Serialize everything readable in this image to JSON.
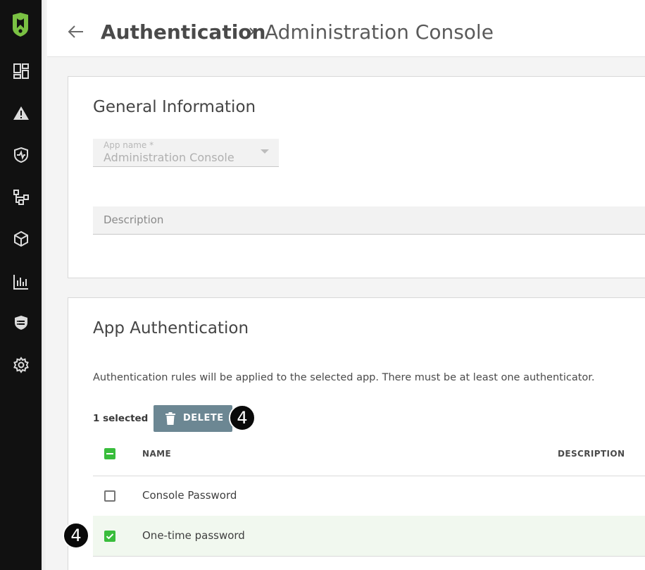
{
  "header": {
    "title": "Authentication",
    "subtitle": "Administration Console"
  },
  "sidebar": {
    "items": [
      {
        "icon": "dashboard-icon"
      },
      {
        "icon": "alert-icon"
      },
      {
        "icon": "shield-pulse-icon"
      },
      {
        "icon": "workflow-icon"
      },
      {
        "icon": "cube-icon"
      },
      {
        "icon": "bar-chart-icon"
      },
      {
        "icon": "policy-shield-icon"
      },
      {
        "icon": "gear-icon"
      }
    ]
  },
  "general": {
    "title": "General Information",
    "app_name_label": "App name *",
    "app_name_value": "Administration Console",
    "description_placeholder": "Description"
  },
  "auth": {
    "title": "App Authentication",
    "help": "Authentication rules will be applied to the selected app. There must be at least one authenticator.",
    "selected_count": "1 selected",
    "delete_label": "DELETE",
    "callout": "4",
    "columns": {
      "name": "NAME",
      "description": "DESCRIPTION"
    },
    "rows": [
      {
        "name": "Console Password",
        "checked": false
      },
      {
        "name": "One-time password",
        "checked": true
      }
    ]
  },
  "colors": {
    "sidebar_bg": "#111111",
    "brand_green": "#7ac143",
    "check_green": "#39bd3c",
    "delete_button": "#6c8793",
    "selected_row": "#f1f8ef"
  }
}
